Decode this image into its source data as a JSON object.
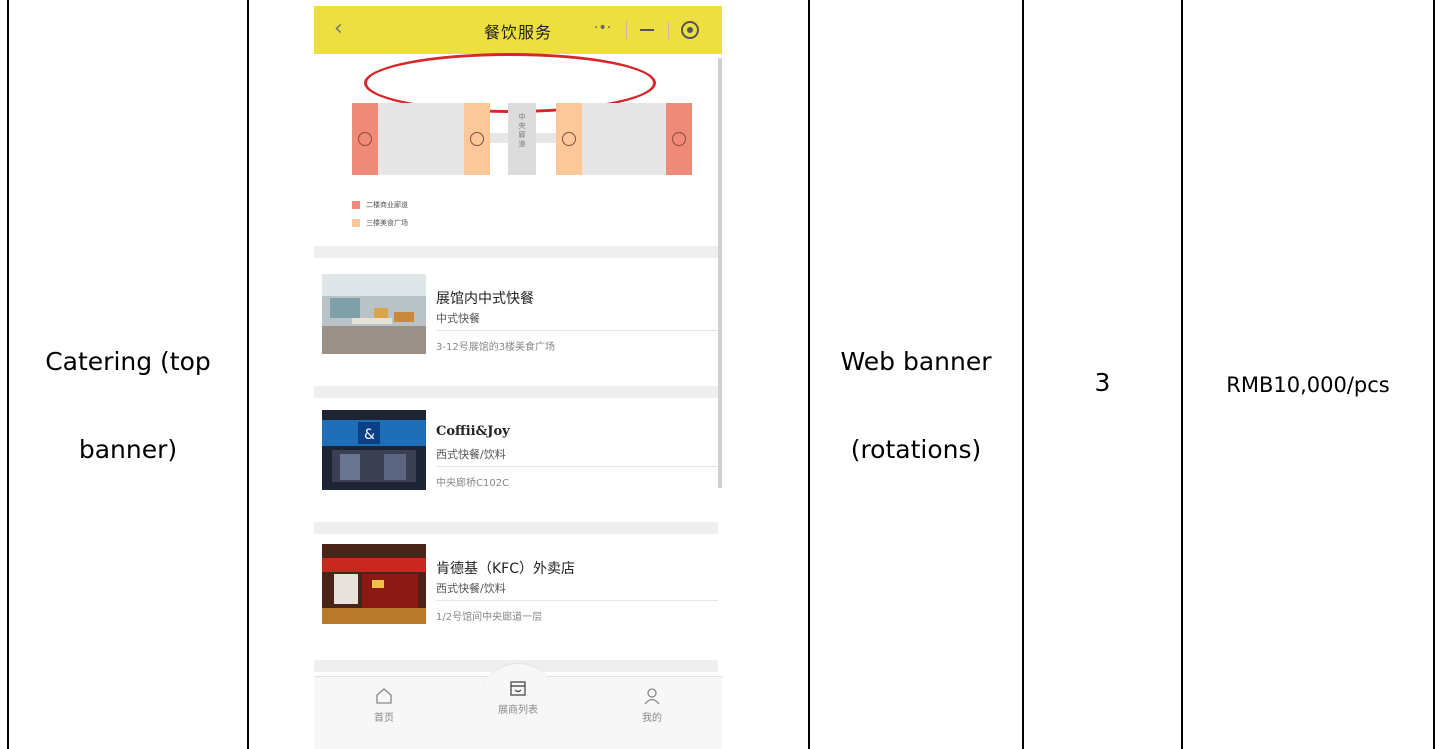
{
  "row": {
    "channel_line1": "Catering (top",
    "channel_line2": "banner)",
    "format_line1": "Web banner",
    "format_line2": "(rotations)",
    "quantity": "3",
    "price": "RMB10,000/pcs"
  },
  "phone": {
    "title": "餐饮服务",
    "map": {
      "center_label": "中央廊道",
      "legend": [
        "二楼商业廊道",
        "三楼美食广场"
      ]
    },
    "colors": {
      "topbar": "#ecdf3f",
      "highlight_oval": "#d8272a",
      "second_floor": "#f08a78",
      "third_floor": "#fcc89a"
    },
    "listings": [
      {
        "name": "展馆内中式快餐",
        "category": "中式快餐",
        "location": "3-12号展馆的3楼美食广场"
      },
      {
        "name": "Coffii&Joy",
        "category": "西式快餐/饮料",
        "location": "中央廊桥C102C"
      },
      {
        "name": "肯德基（KFC）外卖店",
        "category": "西式快餐/饮料",
        "location": "1/2号馆间中央廊道一层"
      }
    ],
    "tabs": [
      {
        "label": "首页",
        "icon": "home-icon"
      },
      {
        "label": "展商列表",
        "icon": "store-icon"
      },
      {
        "label": "我的",
        "icon": "user-icon"
      }
    ]
  }
}
